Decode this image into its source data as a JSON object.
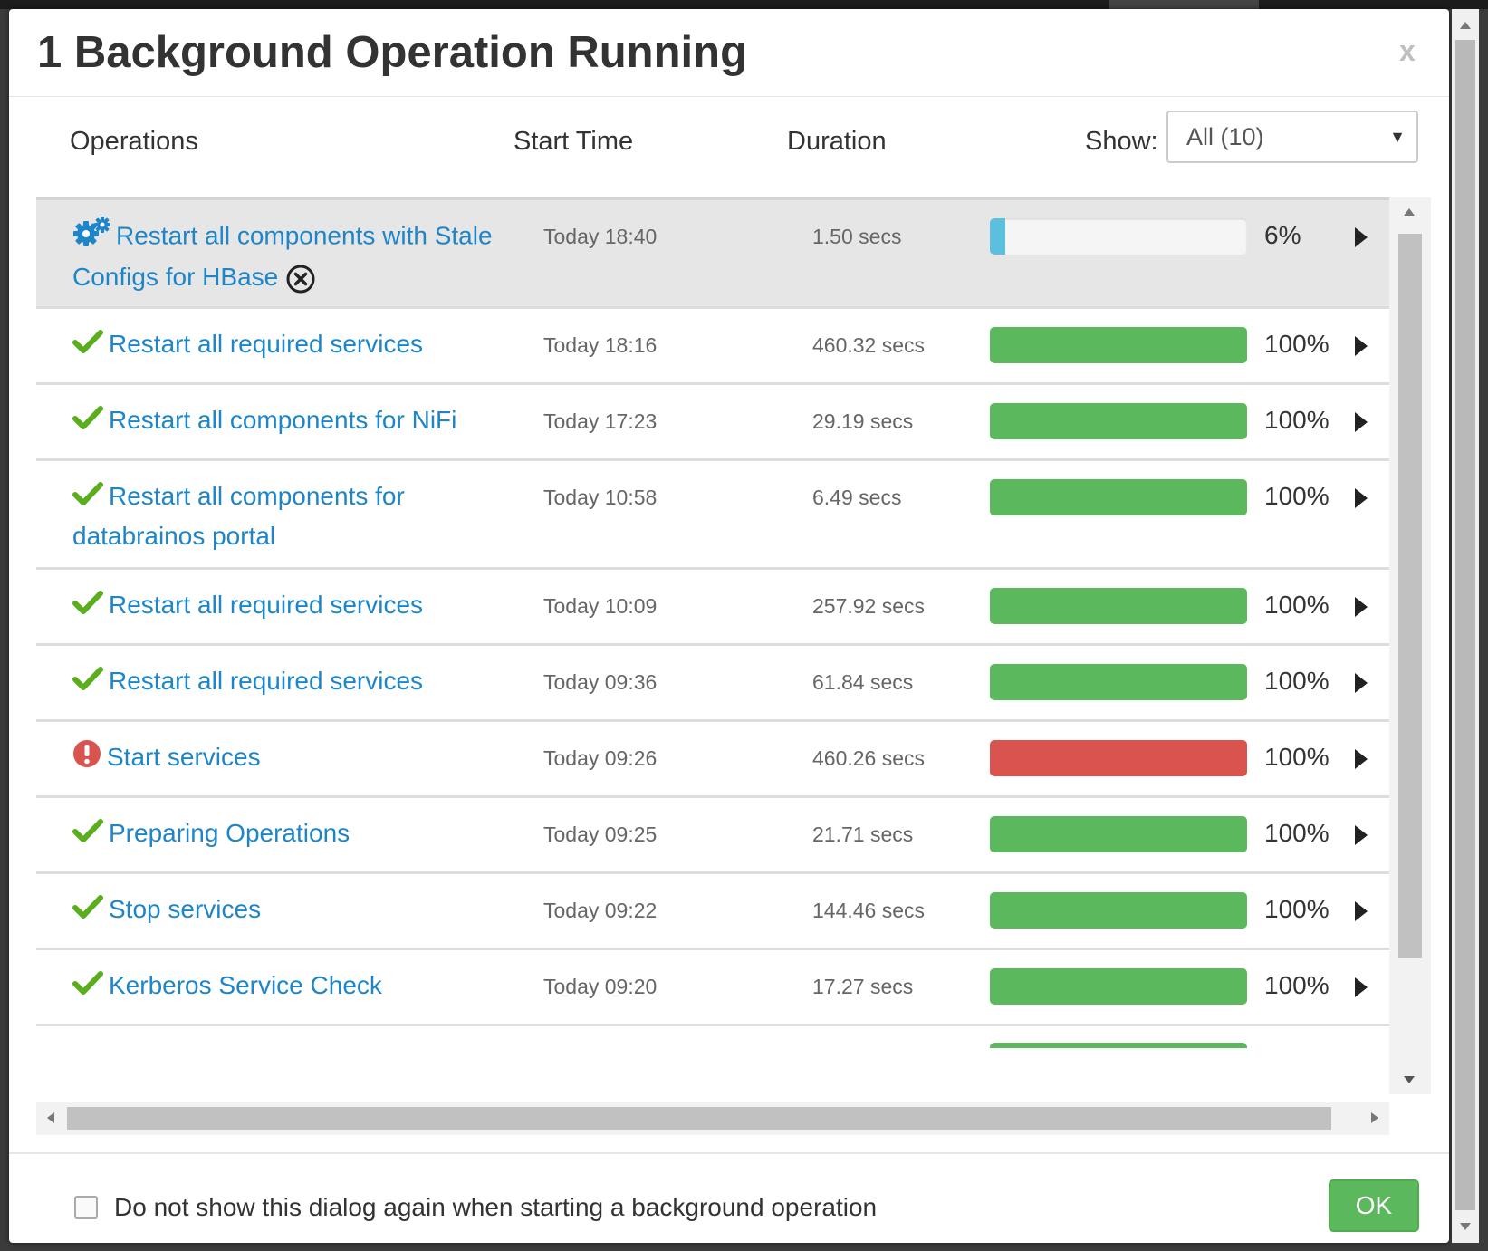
{
  "dialog": {
    "title": "1 Background Operation Running",
    "close_label": "x"
  },
  "columns": {
    "operations": "Operations",
    "start_time": "Start Time",
    "duration": "Duration",
    "show_label": "Show:"
  },
  "filter": {
    "selected": "All (10)"
  },
  "colors": {
    "link": "#1e86c8",
    "success": "#5cb85c",
    "danger": "#d9534f",
    "info": "#5bc0de",
    "running_row_bg": "#e6e6e6"
  },
  "operations": [
    {
      "name": "Restart all components with Stale Configs for HBase",
      "status": "running",
      "icon": "gears-icon",
      "start": "Today 18:40",
      "duration": "1.50 secs",
      "progress": 6,
      "progress_label": "6%"
    },
    {
      "name": "Restart all required services",
      "status": "success",
      "icon": "check-icon",
      "start": "Today 18:16",
      "duration": "460.32 secs",
      "progress": 100,
      "progress_label": "100%"
    },
    {
      "name": "Restart all components for NiFi",
      "status": "success",
      "icon": "check-icon",
      "start": "Today 17:23",
      "duration": "29.19 secs",
      "progress": 100,
      "progress_label": "100%"
    },
    {
      "name": "Restart all components for databrainos portal",
      "status": "success",
      "icon": "check-icon",
      "start": "Today 10:58",
      "duration": "6.49 secs",
      "progress": 100,
      "progress_label": "100%"
    },
    {
      "name": "Restart all required services",
      "status": "success",
      "icon": "check-icon",
      "start": "Today 10:09",
      "duration": "257.92 secs",
      "progress": 100,
      "progress_label": "100%"
    },
    {
      "name": "Restart all required services",
      "status": "success",
      "icon": "check-icon",
      "start": "Today 09:36",
      "duration": "61.84 secs",
      "progress": 100,
      "progress_label": "100%"
    },
    {
      "name": "Start services",
      "status": "failed",
      "icon": "error-icon",
      "start": "Today 09:26",
      "duration": "460.26 secs",
      "progress": 100,
      "progress_label": "100%"
    },
    {
      "name": "Preparing Operations",
      "status": "success",
      "icon": "check-icon",
      "start": "Today 09:25",
      "duration": "21.71 secs",
      "progress": 100,
      "progress_label": "100%"
    },
    {
      "name": "Stop services",
      "status": "success",
      "icon": "check-icon",
      "start": "Today 09:22",
      "duration": "144.46 secs",
      "progress": 100,
      "progress_label": "100%"
    },
    {
      "name": "Kerberos Service Check",
      "status": "success",
      "icon": "check-icon",
      "start": "Today 09:20",
      "duration": "17.27 secs",
      "progress": 100,
      "progress_label": "100%"
    }
  ],
  "footer": {
    "checkbox_label": "Do not show this dialog again when starting a background operation",
    "checkbox_checked": false,
    "ok_label": "OK"
  }
}
